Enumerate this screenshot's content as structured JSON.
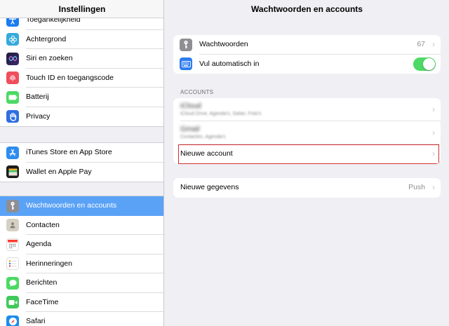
{
  "sidebar": {
    "title": "Instellingen",
    "group1": [
      {
        "label": "Toegankelijkheid",
        "icon": "accessibility-icon",
        "color": "#1a7cf2"
      },
      {
        "label": "Achtergrond",
        "icon": "wallpaper-icon",
        "color": "#35aadc"
      },
      {
        "label": "Siri en zoeken",
        "icon": "siri-icon",
        "color": "#1f1f3a"
      },
      {
        "label": "Touch ID en toegangscode",
        "icon": "fingerprint-icon",
        "color": "#ef4e5d"
      },
      {
        "label": "Batterij",
        "icon": "battery-icon",
        "color": "#4cd964"
      },
      {
        "label": "Privacy",
        "icon": "hand-icon",
        "color": "#2f6ee0"
      }
    ],
    "group2": [
      {
        "label": "iTunes Store en App Store",
        "icon": "app-store-icon",
        "color": "#2d8cf0"
      },
      {
        "label": "Wallet en Apple Pay",
        "icon": "wallet-icon",
        "color": "#1c1c1e"
      }
    ],
    "group3": [
      {
        "label": "Wachtwoorden en accounts",
        "icon": "key-icon",
        "color": "#8e8e93",
        "selected": true
      },
      {
        "label": "Contacten",
        "icon": "contacts-icon",
        "color": "#c9c4b8"
      },
      {
        "label": "Agenda",
        "icon": "calendar-icon",
        "color": "#ffffff"
      },
      {
        "label": "Herinneringen",
        "icon": "reminders-icon",
        "color": "#ffffff"
      },
      {
        "label": "Berichten",
        "icon": "messages-icon",
        "color": "#4cd964"
      },
      {
        "label": "FaceTime",
        "icon": "facetime-icon",
        "color": "#3fc95a"
      },
      {
        "label": "Safari",
        "icon": "safari-icon",
        "color": "#1a8cf0"
      }
    ]
  },
  "main": {
    "title": "Wachtwoorden en accounts",
    "passwords": {
      "label": "Wachtwoorden",
      "count": "67",
      "icon": "key-icon"
    },
    "autofill": {
      "label": "Vul automatisch in",
      "icon": "keyboard-icon",
      "enabled": true
    },
    "accounts_header": "ACCOUNTS",
    "accounts": [
      {
        "name": "iCloud",
        "detail": "iCloud Drive, Agenda's, Safari, Foto's"
      },
      {
        "name": "Gmail",
        "detail": "Contacten, Agenda's"
      }
    ],
    "new_account": "Nieuwe account",
    "fetch": {
      "label": "Nieuwe gegevens",
      "value": "Push"
    }
  },
  "colors": {
    "accent": "#5aa2f6",
    "toggle_on": "#4cd964",
    "highlight": "#d32f2f"
  }
}
